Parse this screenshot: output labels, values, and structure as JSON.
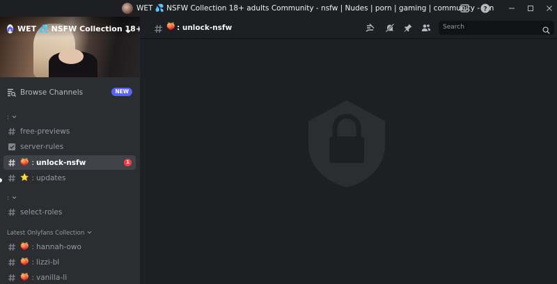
{
  "window": {
    "title": "WET 💦 NSFW Collection 18+ adults Community - nsfw | Nudes | porn | gaming | community - fun"
  },
  "server": {
    "name": "WET 💦 NSFW Collection 18+ ..."
  },
  "sidebar": {
    "browse_label": "Browse Channels",
    "new_badge": "NEW",
    "categories": [
      {
        "label": ":"
      },
      {
        "label": ":"
      },
      {
        "label": "Latest Onlyfans Collection"
      }
    ],
    "channels": [
      {
        "name": "free-previews",
        "icon": "hash-icon",
        "emoji": "",
        "active": false
      },
      {
        "name": "server-rules",
        "icon": "rules-icon",
        "emoji": "",
        "active": false
      },
      {
        "name": "unlock-nsfw",
        "icon": "hash-icon",
        "emoji": "🍑",
        "sep": ":",
        "active": true,
        "badge": "1"
      },
      {
        "name": "updates",
        "icon": "hash-icon",
        "emoji": "⭐",
        "sep": ":",
        "active": false
      },
      {
        "name": "select-roles",
        "icon": "hash-icon",
        "emoji": "",
        "active": false
      },
      {
        "name": "hannah-owo",
        "icon": "hash-icon",
        "emoji": "🍑",
        "sep": ":",
        "active": false
      },
      {
        "name": "lizzi-bl",
        "icon": "hash-icon",
        "emoji": "🍑",
        "sep": ":",
        "active": false
      },
      {
        "name": "vanilla-li",
        "icon": "hash-icon",
        "emoji": "🍑",
        "sep": ":",
        "active": false
      }
    ]
  },
  "header": {
    "channel_emoji": "🍑",
    "channel_sep": ":",
    "channel_name": "unlock-nsfw",
    "search_placeholder": "Search"
  },
  "colors": {
    "accent": "#5865f2",
    "unread": "#f23f42",
    "sidebar_bg": "#2b2d31",
    "main_bg": "#1e1f22"
  }
}
